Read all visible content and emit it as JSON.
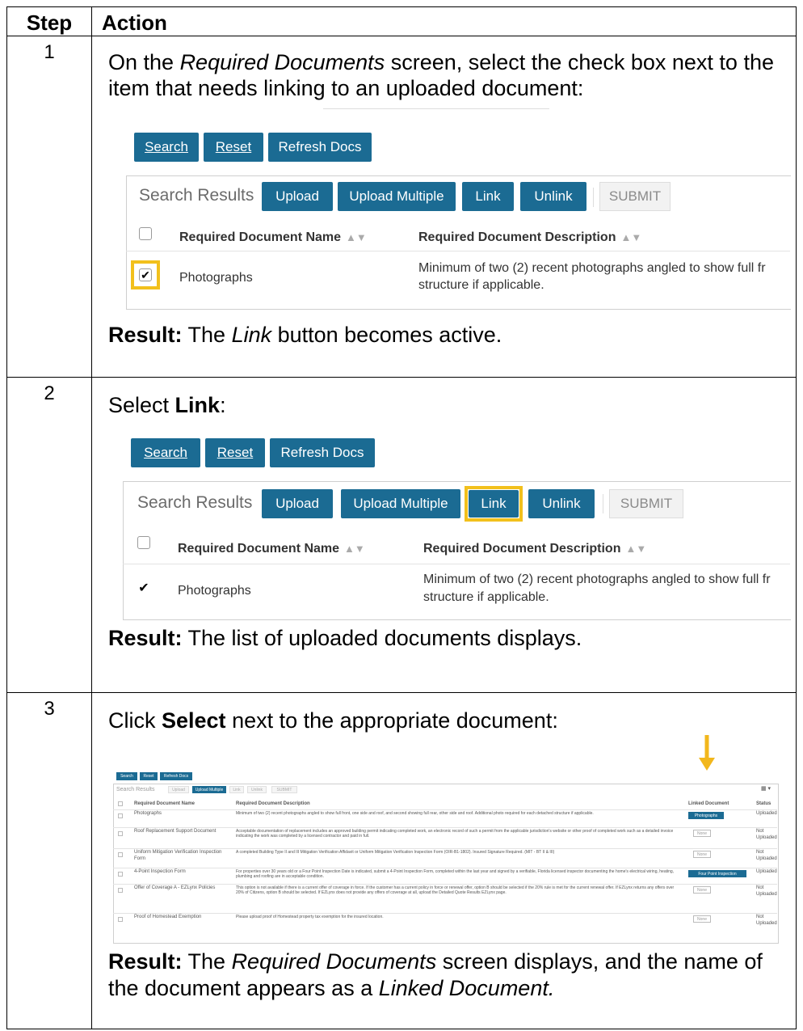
{
  "headers": {
    "step": "Step",
    "action": "Action"
  },
  "steps": [
    {
      "num": "1",
      "instr_pre": "On the ",
      "instr_em": "Required Documents",
      "instr_post": " screen, select the check box next to the item that needs linking to an uploaded document:",
      "result_label": "Result:",
      "result_pre": " The ",
      "result_em": "Link",
      "result_post": " button becomes active."
    },
    {
      "num": "2",
      "instr_pre": "Select ",
      "instr_bold": "Link",
      "instr_post": ":",
      "result_label": "Result:",
      "result_text": " The list of uploaded documents displays."
    },
    {
      "num": "3",
      "instr_pre": "Click ",
      "instr_bold": "Select",
      "instr_post": " next to the appropriate document:",
      "result_label": "Result:",
      "result_pre": " The ",
      "result_em": "Required Documents",
      "result_mid": " screen displays, and the name of the document appears as a ",
      "result_em2": "Linked Document."
    }
  ],
  "ui": {
    "search": "Search",
    "reset": "Reset",
    "refresh": "Refresh Docs",
    "panel_title": "Search Results",
    "upload": "Upload",
    "upload_multiple": "Upload Multiple",
    "link": "Link",
    "unlink": "Unlink",
    "submit": "SUBMIT",
    "col_name": "Required Document Name",
    "col_desc": "Required Document Description",
    "row_name": "Photographs",
    "row_desc_1": "Minimum of two (2) recent photographs angled to show full fr",
    "row_desc_2": "structure if applicable."
  },
  "mini": {
    "search": "Search",
    "reset": "Reset",
    "refresh": "Refresh Docs",
    "panel_title": "Search Results",
    "upload": "Upload",
    "upload_multiple": "Upload Multiple",
    "link": "Link",
    "unlink": "Unlink",
    "submit": "SUBMIT",
    "col_name": "Required Document Name",
    "col_desc": "Required Document Description",
    "col_linked": "Linked Document",
    "col_status": "Status",
    "rows": [
      {
        "name": "Photographs",
        "desc": "Minimum of two (2) recent photographs angled to show full front, one side and roof, and second showing full rear, other side and roof. Additional photo required for each detached structure if applicable.",
        "linked": "Photographs",
        "status": "Uploaded"
      },
      {
        "name": "Roof Replacement Support Document",
        "desc": "Acceptable documentation of replacement includes an approved building permit indicating completed work, an electronic record of such a permit from the applicable jurisdiction's website or other proof of completed work such as a detailed invoice indicating the work was completed by a licensed contractor and paid in full.",
        "linked": "None",
        "status": "Not Uploaded"
      },
      {
        "name": "Uniform Mitigation Verification Inspection Form",
        "desc": "A completed Building Type II and III Mitigation Verification Affidavit or Uniform Mitigation Verification Inspection Form (OIR-B1-1802). Insured Signature Required. (MIT - BT II & III)",
        "linked": "None",
        "status": "Not Uploaded"
      },
      {
        "name": "4-Point Inspection Form",
        "desc": "For properties over 30 years old or a Four Point Inspection Date is indicated, submit a 4-Point Inspection Form, completed within the last year and signed by a verifiable, Florida licensed inspector documenting the home's electrical wiring, heating, plumbing and roofing are in acceptable condition.",
        "linked": "Four Point Inspection",
        "status": "Uploaded"
      },
      {
        "name": "Offer of Coverage A - EZLynx Policies",
        "desc": "This option is not available if there is a current offer of coverage in force. If the customer has a current policy in force or renewal offer, option B should be selected if the 20% rule is met for the current renewal offer. If EZLynx returns any offers over 20% of Citizens, option B should be selected. If EZLynx does not provide any offers of coverage at all, upload the Detailed Quote Results EZLynx page.",
        "linked": "None",
        "status": "Not Uploaded"
      },
      {
        "name": "Proof of Homestead Exemption",
        "desc": "Please upload proof of Homestead property tax exemption for the insured location.",
        "linked": "None",
        "status": "Not Uploaded"
      }
    ]
  },
  "colors": {
    "button": "#1b6b93",
    "highlight": "#f2c01c",
    "arrow": "#f2b71c"
  }
}
